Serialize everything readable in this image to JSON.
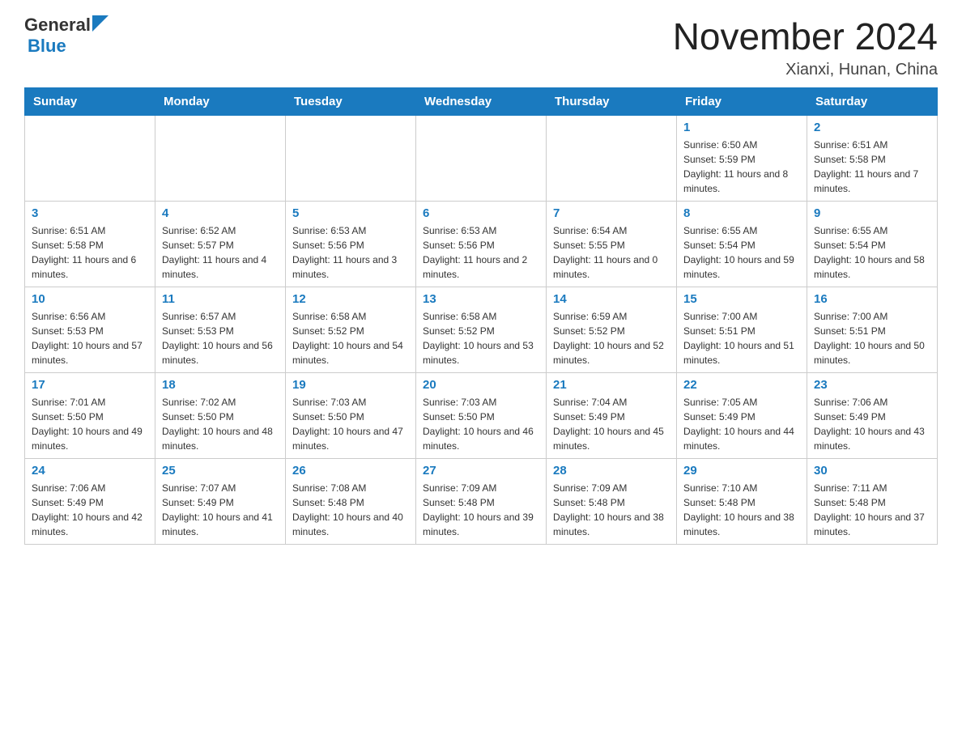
{
  "header": {
    "logo_general": "General",
    "logo_blue": "Blue",
    "title": "November 2024",
    "location": "Xianxi, Hunan, China"
  },
  "weekdays": [
    "Sunday",
    "Monday",
    "Tuesday",
    "Wednesday",
    "Thursday",
    "Friday",
    "Saturday"
  ],
  "weeks": [
    [
      {
        "day": "",
        "info": ""
      },
      {
        "day": "",
        "info": ""
      },
      {
        "day": "",
        "info": ""
      },
      {
        "day": "",
        "info": ""
      },
      {
        "day": "",
        "info": ""
      },
      {
        "day": "1",
        "info": "Sunrise: 6:50 AM\nSunset: 5:59 PM\nDaylight: 11 hours and 8 minutes."
      },
      {
        "day": "2",
        "info": "Sunrise: 6:51 AM\nSunset: 5:58 PM\nDaylight: 11 hours and 7 minutes."
      }
    ],
    [
      {
        "day": "3",
        "info": "Sunrise: 6:51 AM\nSunset: 5:58 PM\nDaylight: 11 hours and 6 minutes."
      },
      {
        "day": "4",
        "info": "Sunrise: 6:52 AM\nSunset: 5:57 PM\nDaylight: 11 hours and 4 minutes."
      },
      {
        "day": "5",
        "info": "Sunrise: 6:53 AM\nSunset: 5:56 PM\nDaylight: 11 hours and 3 minutes."
      },
      {
        "day": "6",
        "info": "Sunrise: 6:53 AM\nSunset: 5:56 PM\nDaylight: 11 hours and 2 minutes."
      },
      {
        "day": "7",
        "info": "Sunrise: 6:54 AM\nSunset: 5:55 PM\nDaylight: 11 hours and 0 minutes."
      },
      {
        "day": "8",
        "info": "Sunrise: 6:55 AM\nSunset: 5:54 PM\nDaylight: 10 hours and 59 minutes."
      },
      {
        "day": "9",
        "info": "Sunrise: 6:55 AM\nSunset: 5:54 PM\nDaylight: 10 hours and 58 minutes."
      }
    ],
    [
      {
        "day": "10",
        "info": "Sunrise: 6:56 AM\nSunset: 5:53 PM\nDaylight: 10 hours and 57 minutes."
      },
      {
        "day": "11",
        "info": "Sunrise: 6:57 AM\nSunset: 5:53 PM\nDaylight: 10 hours and 56 minutes."
      },
      {
        "day": "12",
        "info": "Sunrise: 6:58 AM\nSunset: 5:52 PM\nDaylight: 10 hours and 54 minutes."
      },
      {
        "day": "13",
        "info": "Sunrise: 6:58 AM\nSunset: 5:52 PM\nDaylight: 10 hours and 53 minutes."
      },
      {
        "day": "14",
        "info": "Sunrise: 6:59 AM\nSunset: 5:52 PM\nDaylight: 10 hours and 52 minutes."
      },
      {
        "day": "15",
        "info": "Sunrise: 7:00 AM\nSunset: 5:51 PM\nDaylight: 10 hours and 51 minutes."
      },
      {
        "day": "16",
        "info": "Sunrise: 7:00 AM\nSunset: 5:51 PM\nDaylight: 10 hours and 50 minutes."
      }
    ],
    [
      {
        "day": "17",
        "info": "Sunrise: 7:01 AM\nSunset: 5:50 PM\nDaylight: 10 hours and 49 minutes."
      },
      {
        "day": "18",
        "info": "Sunrise: 7:02 AM\nSunset: 5:50 PM\nDaylight: 10 hours and 48 minutes."
      },
      {
        "day": "19",
        "info": "Sunrise: 7:03 AM\nSunset: 5:50 PM\nDaylight: 10 hours and 47 minutes."
      },
      {
        "day": "20",
        "info": "Sunrise: 7:03 AM\nSunset: 5:50 PM\nDaylight: 10 hours and 46 minutes."
      },
      {
        "day": "21",
        "info": "Sunrise: 7:04 AM\nSunset: 5:49 PM\nDaylight: 10 hours and 45 minutes."
      },
      {
        "day": "22",
        "info": "Sunrise: 7:05 AM\nSunset: 5:49 PM\nDaylight: 10 hours and 44 minutes."
      },
      {
        "day": "23",
        "info": "Sunrise: 7:06 AM\nSunset: 5:49 PM\nDaylight: 10 hours and 43 minutes."
      }
    ],
    [
      {
        "day": "24",
        "info": "Sunrise: 7:06 AM\nSunset: 5:49 PM\nDaylight: 10 hours and 42 minutes."
      },
      {
        "day": "25",
        "info": "Sunrise: 7:07 AM\nSunset: 5:49 PM\nDaylight: 10 hours and 41 minutes."
      },
      {
        "day": "26",
        "info": "Sunrise: 7:08 AM\nSunset: 5:48 PM\nDaylight: 10 hours and 40 minutes."
      },
      {
        "day": "27",
        "info": "Sunrise: 7:09 AM\nSunset: 5:48 PM\nDaylight: 10 hours and 39 minutes."
      },
      {
        "day": "28",
        "info": "Sunrise: 7:09 AM\nSunset: 5:48 PM\nDaylight: 10 hours and 38 minutes."
      },
      {
        "day": "29",
        "info": "Sunrise: 7:10 AM\nSunset: 5:48 PM\nDaylight: 10 hours and 38 minutes."
      },
      {
        "day": "30",
        "info": "Sunrise: 7:11 AM\nSunset: 5:48 PM\nDaylight: 10 hours and 37 minutes."
      }
    ]
  ]
}
